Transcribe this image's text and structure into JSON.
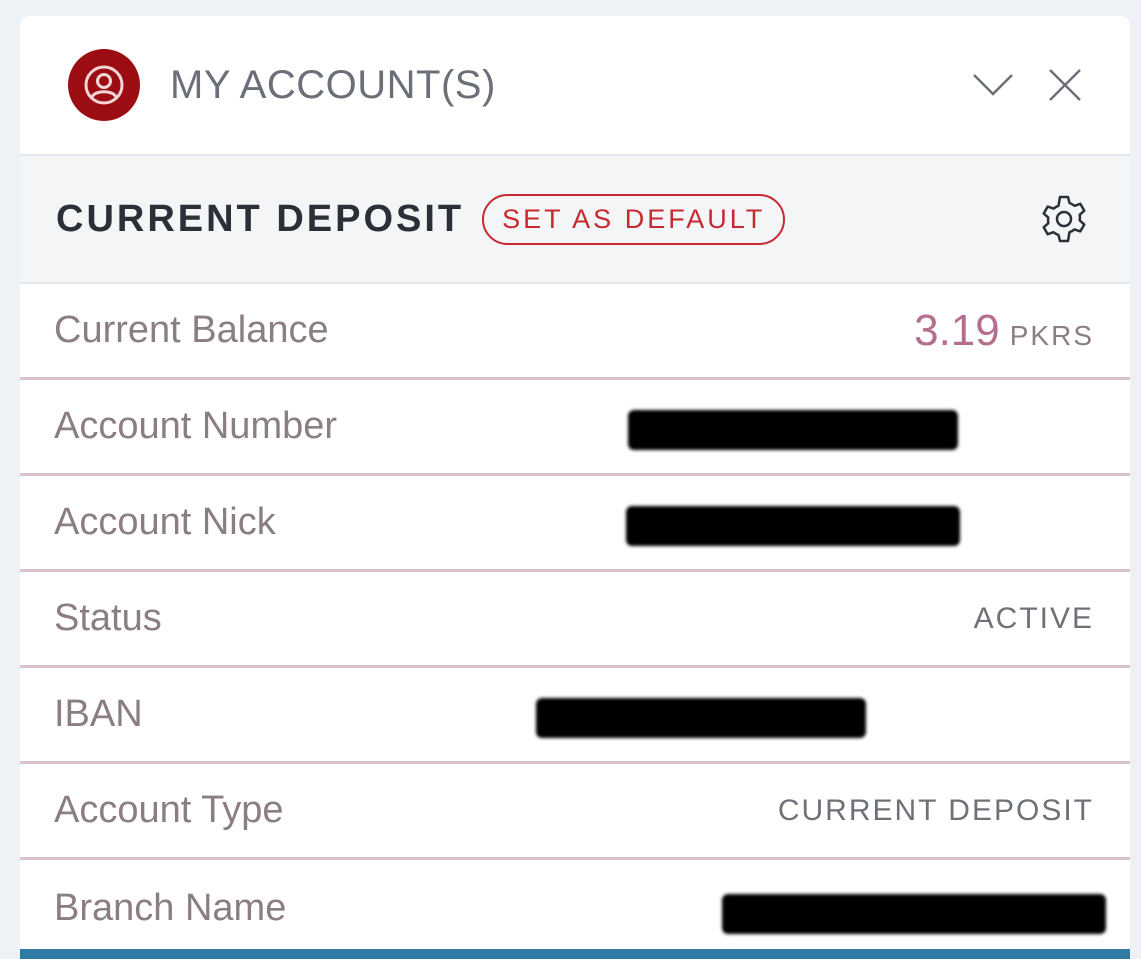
{
  "header": {
    "title": "MY ACCOUNT(S)",
    "avatar_icon": "user-circle-icon",
    "collapse_icon": "chevron-down-icon",
    "close_icon": "close-icon"
  },
  "account": {
    "type_title": "CURRENT DEPOSIT",
    "set_default_label": "SET AS DEFAULT",
    "settings_icon": "gear-icon"
  },
  "details": {
    "current_balance": {
      "label": "Current Balance",
      "amount": "3.19",
      "currency": "PKRS"
    },
    "account_number": {
      "label": "Account Number",
      "value": ""
    },
    "account_nick": {
      "label": "Account Nick",
      "value": ""
    },
    "status": {
      "label": "Status",
      "value": "ACTIVE"
    },
    "iban": {
      "label": "IBAN",
      "value": ""
    },
    "account_type": {
      "label": "Account Type",
      "value": "CURRENT DEPOSIT"
    },
    "branch_name": {
      "label": "Branch Name",
      "value": ""
    }
  },
  "colors": {
    "brand_red": "#9b0d12",
    "accent_red": "#c8292f",
    "footer_blue": "#2f7ba3"
  }
}
